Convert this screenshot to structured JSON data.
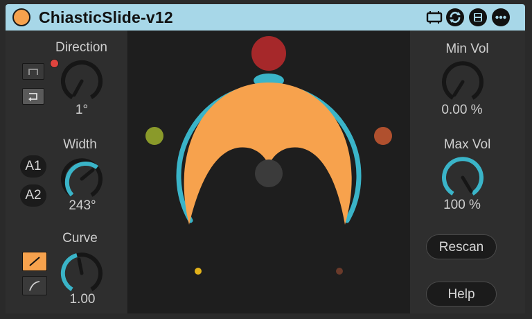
{
  "title": "ChiasticSlide-v12",
  "colors": {
    "accent": "#f7a24d",
    "teal": "#3ab4c8",
    "titlebar": "#a7d7e8",
    "dot_red": "#a6282a",
    "dot_olive": "#8a9a2a",
    "dot_rust": "#b0502e",
    "dot_yellow": "#e2b21a"
  },
  "toolbar": {
    "icons": [
      "device-icon",
      "refresh-icon",
      "save-icon",
      "more-icon"
    ]
  },
  "direction": {
    "label": "Direction",
    "value": "1°"
  },
  "width": {
    "label": "Width",
    "value": "243°",
    "a1": "A1",
    "a2": "A2"
  },
  "curve": {
    "label": "Curve",
    "value": "1.00"
  },
  "min_vol": {
    "label": "Min Vol",
    "value": "0.00 %"
  },
  "max_vol": {
    "label": "Max Vol",
    "value": "100 %",
    "level": 1.0
  },
  "buttons": {
    "rescan": "Rescan",
    "help": "Help"
  }
}
